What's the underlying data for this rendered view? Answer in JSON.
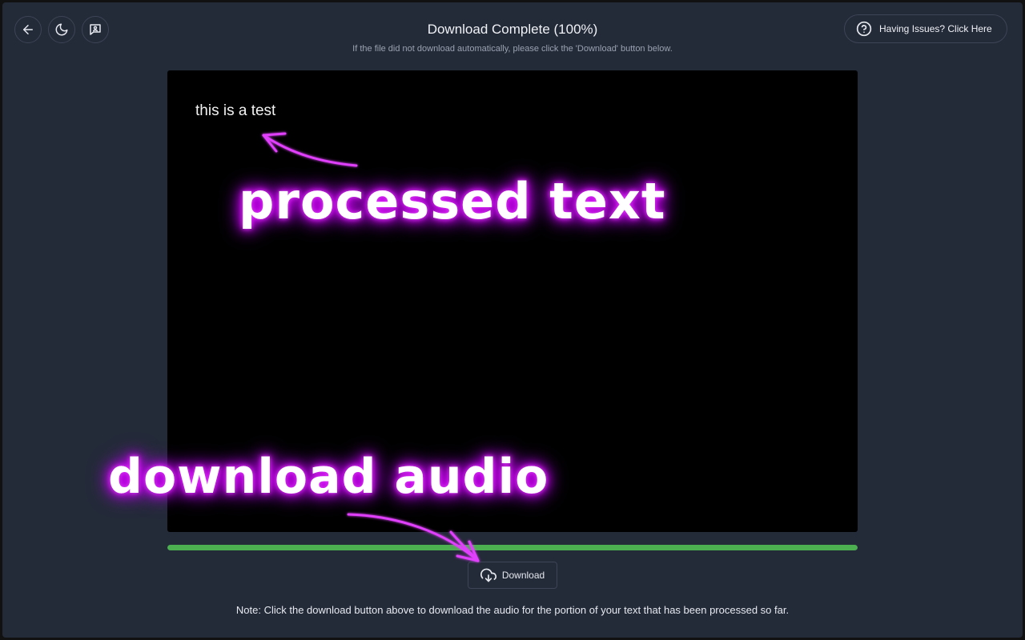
{
  "header": {
    "title": "Download Complete (100%)",
    "subtitle": "If the file did not download automatically, please click the 'Download' button below.",
    "help_label": "Having Issues? Click Here"
  },
  "preview": {
    "text": "this is a test"
  },
  "progress": {
    "percent": 100,
    "color": "#4caf50"
  },
  "download": {
    "label": "Download"
  },
  "note": "Note: Click the download button above to download the audio for the portion of your text that has been processed so far.",
  "annotations": {
    "processed_text": "processed text",
    "download_audio": "download audio",
    "color": "#e040fb"
  },
  "icons": {
    "back": "arrow-left-icon",
    "theme": "moon-icon",
    "feedback": "message-icon",
    "help": "question-circle-icon",
    "download": "cloud-download-icon"
  }
}
